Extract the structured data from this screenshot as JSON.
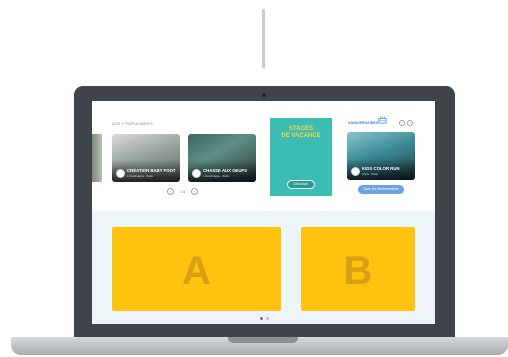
{
  "populaires": {
    "label": "LES + POPULAIRES",
    "cards": [
      {
        "title": "CRÉATION BABY FOOT",
        "subtitle": "1 Festimagne · Paris"
      },
      {
        "title": "CHASSE AUX OEUFS",
        "subtitle": "1 Festimagne · Paris"
      }
    ],
    "pager": {
      "prev": "‹",
      "text": "1/4",
      "next": "›"
    }
  },
  "promo": {
    "title_line1": "STAGES",
    "title_line2": "DE VACANCE",
    "button": "Découvrir"
  },
  "anniversaires": {
    "label": "ANNIVERSAIRES",
    "prev": "‹",
    "next": "›",
    "card": {
      "title": "KIDS COLOR RUN",
      "subtitle": "Anniv · Paris"
    },
    "button": "Tous les anniversaires"
  },
  "tiles": [
    {
      "letter": "A"
    },
    {
      "letter": "B"
    }
  ],
  "colors": {
    "accent_teal": "#3cbdb4",
    "accent_yellow": "#ffc20e",
    "accent_blue": "#6fa3e0",
    "laptop": "#3e4449"
  }
}
